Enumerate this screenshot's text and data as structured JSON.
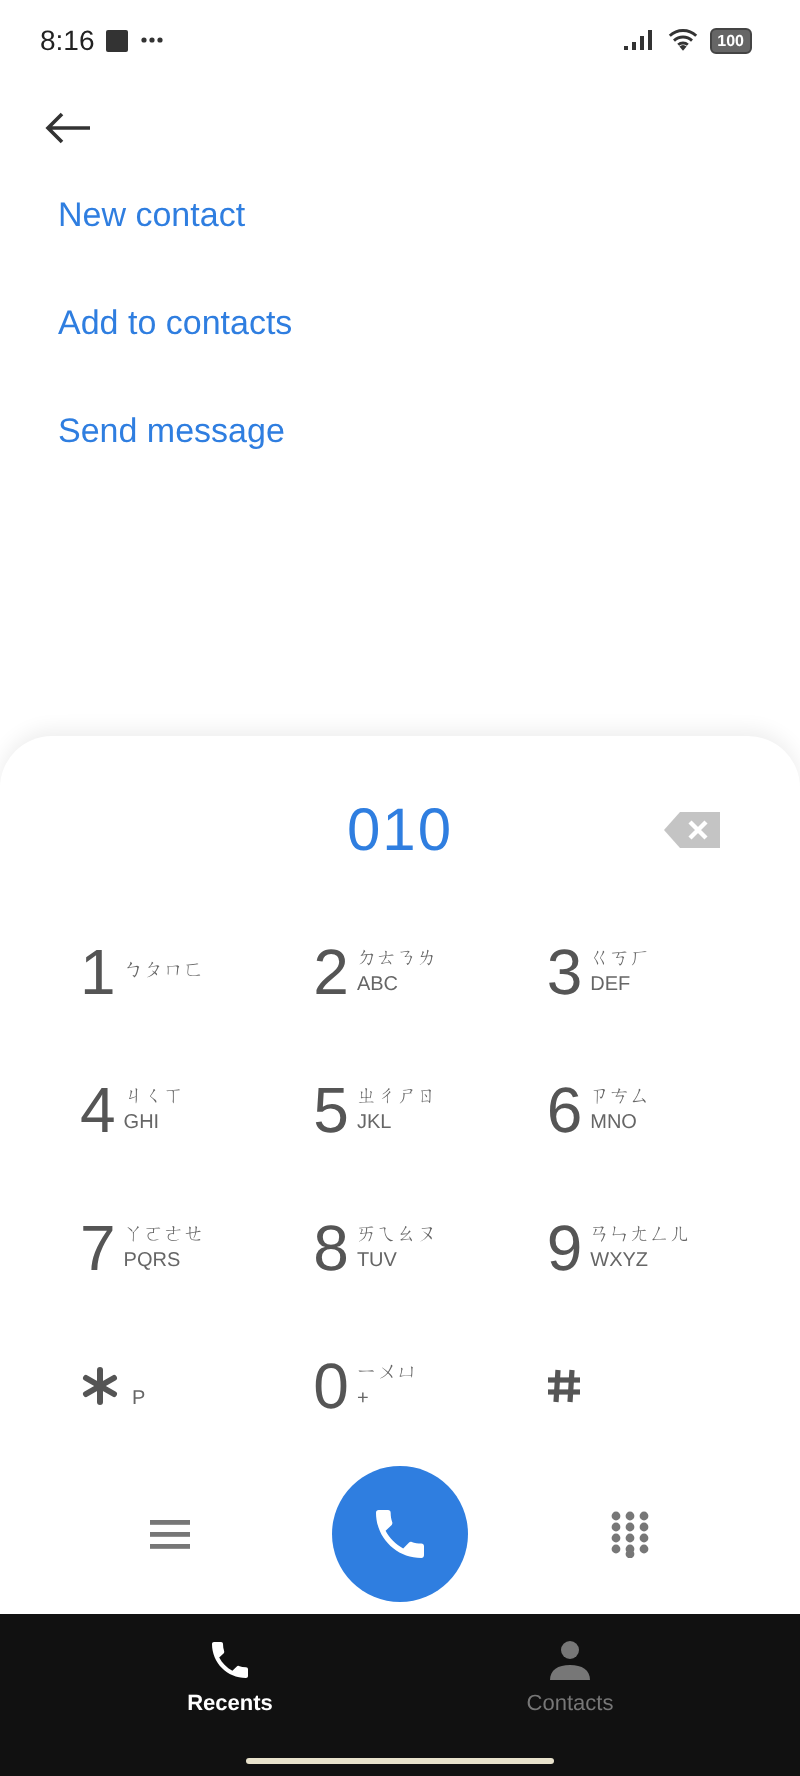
{
  "status_bar": {
    "time": "8:16",
    "battery": "100"
  },
  "actions": [
    {
      "label": "New contact"
    },
    {
      "label": "Add to contacts"
    },
    {
      "label": "Send message"
    }
  ],
  "dialpad": {
    "number": "010",
    "keys": [
      {
        "kind": "digit",
        "digit": "1",
        "zhuyin": "ㄅㄆㄇㄈ"
      },
      {
        "kind": "digit",
        "digit": "2",
        "zhuyin": "ㄉㄊㄋㄌ",
        "letters": "ABC"
      },
      {
        "kind": "digit",
        "digit": "3",
        "zhuyin": "ㄍㄎㄏ",
        "letters": "DEF"
      },
      {
        "kind": "digit",
        "digit": "4",
        "zhuyin": "ㄐㄑㄒ",
        "letters": "GHI"
      },
      {
        "kind": "digit",
        "digit": "5",
        "zhuyin": "ㄓㄔㄕㄖ",
        "letters": "JKL"
      },
      {
        "kind": "digit",
        "digit": "6",
        "zhuyin": "ㄗㄘㄙ",
        "letters": "MNO"
      },
      {
        "kind": "digit",
        "digit": "7",
        "zhuyin": "ㄚㄛㄜㄝ",
        "letters": "PQRS"
      },
      {
        "kind": "digit",
        "digit": "8",
        "zhuyin": "ㄞㄟㄠㄡ",
        "letters": "TUV"
      },
      {
        "kind": "digit",
        "digit": "9",
        "zhuyin": "ㄢㄣㄤㄥㄦ",
        "letters": "WXYZ"
      },
      {
        "kind": "star",
        "letters": "P"
      },
      {
        "kind": "digit",
        "digit": "0",
        "zhuyin": "ㄧㄨㄩ",
        "letters": "+"
      },
      {
        "kind": "hash"
      }
    ]
  },
  "tabs": [
    {
      "label": "Recents",
      "kind": "phone",
      "selected": true
    },
    {
      "label": "Contacts",
      "kind": "person",
      "selected": false
    }
  ]
}
